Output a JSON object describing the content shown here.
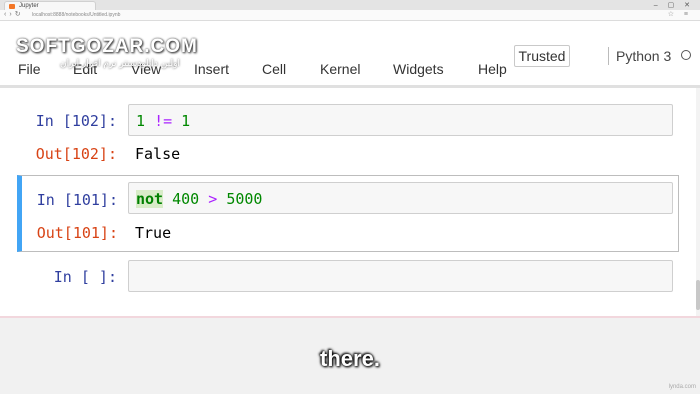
{
  "browser": {
    "tab_title": "Jupyter",
    "url": "localhost:8888/notebooks/Untitled.ipynb",
    "nav_icons": [
      "back-icon",
      "forward-icon",
      "reload-icon"
    ]
  },
  "watermark": {
    "text": "SOFTGOZAR.COM",
    "subtext": "اولین دانلودسنتر نرم افزار ایران"
  },
  "header": {
    "trusted_label": "Trusted",
    "kernel_name": "Python 3",
    "kernel_status": "idle"
  },
  "menu": {
    "items": [
      "File",
      "Edit",
      "View",
      "Insert",
      "Cell",
      "Kernel",
      "Widgets",
      "Help"
    ]
  },
  "cells": [
    {
      "in_prompt": "In [102]:",
      "code_tokens": [
        "1",
        " ",
        "!=",
        " ",
        "1"
      ],
      "out_prompt": "Out[102]:",
      "output": "False"
    },
    {
      "in_prompt": "In [101]:",
      "code_tokens": [
        "not",
        " ",
        "400",
        " ",
        ">",
        " ",
        "5000"
      ],
      "out_prompt": "Out[101]:",
      "output": "True"
    },
    {
      "in_prompt": "In [ ]:"
    }
  ],
  "subtitle": "there.",
  "brand": "lynda.com",
  "colors": {
    "selected_border": "#42a5f5",
    "in_prompt": "#303f9f",
    "out_prompt": "#d84315",
    "number": "#008800",
    "operator": "#aa22ff",
    "keyword": "#008000"
  }
}
